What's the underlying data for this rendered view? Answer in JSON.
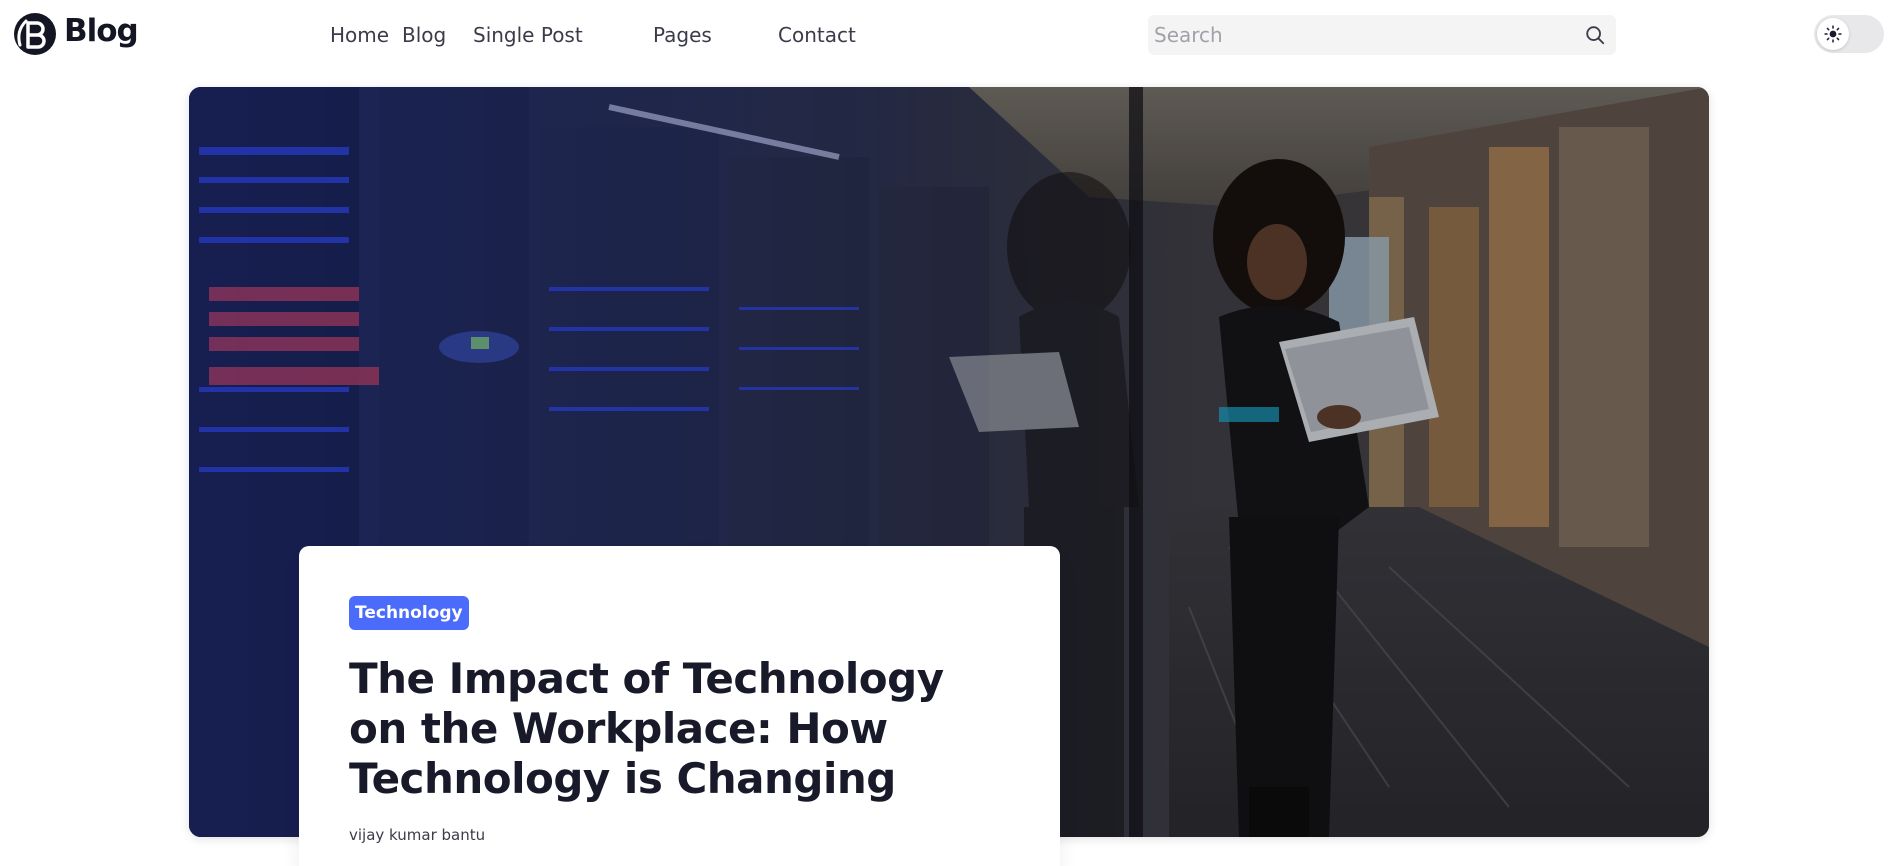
{
  "header": {
    "logo_text": "Blog",
    "nav": [
      "Home",
      "Blog",
      "Single Post",
      "Pages",
      "Contact"
    ],
    "search": {
      "placeholder": "Search",
      "value": ""
    },
    "theme_toggle": {
      "mode": "light",
      "icon": "sun-icon"
    }
  },
  "hero": {
    "image_alt": "Woman holding a laptop leaning against a glass wall in a server room corridor",
    "card": {
      "category": "Technology",
      "title": "The Impact of Technology on the Workplace: How Technology is Changing",
      "author": "vijay kumar bantu"
    }
  },
  "colors": {
    "accent": "#4b6bfb",
    "text": "#181a2a",
    "search_bg": "#f4f4f5",
    "toggle_bg": "#e8e8ea"
  }
}
